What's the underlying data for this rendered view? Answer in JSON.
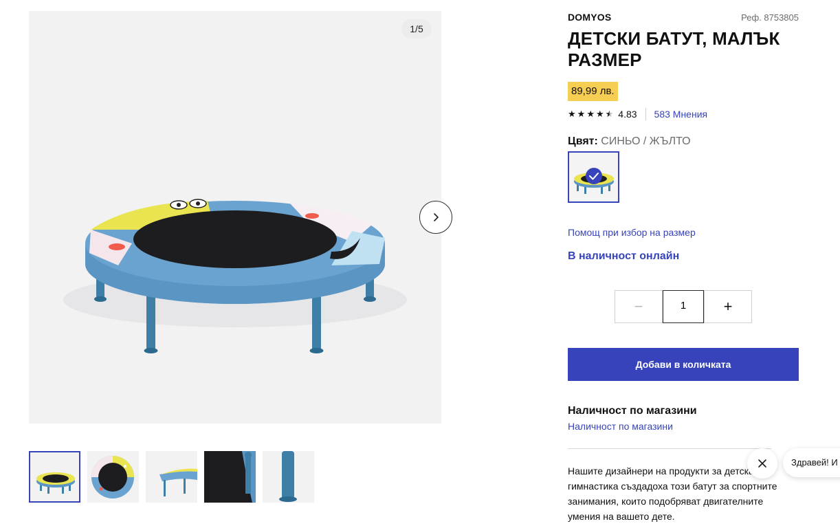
{
  "gallery": {
    "counter": "1/5",
    "next_icon": "chevron-right-icon",
    "thumbnails": [
      "trampoline-front",
      "trampoline-top",
      "trampoline-side",
      "trampoline-detail",
      "trampoline-leg"
    ]
  },
  "product": {
    "brand": "DOMYOS",
    "ref": "Реф. 8753805",
    "title": "ДЕТСКИ БАТУТ, МАЛЪК РАЗМЕР",
    "price": "89,99 лв.",
    "rating_value": "4.83",
    "rating_stars": 4.5,
    "reviews": "583 Мнения"
  },
  "color": {
    "label": "Цвят:",
    "value": "СИНЬО / ЖЪЛТО"
  },
  "links": {
    "size_help": "Помощ при избор на размер",
    "stock_online": "В наличност онлайн"
  },
  "quantity": {
    "minus": "−",
    "value": "1",
    "plus": "+"
  },
  "cart": {
    "add_label": "Добави в количката"
  },
  "stores": {
    "heading": "Наличност по магазини",
    "link": "Наличност по магазини"
  },
  "description": "Нашите дизайнери на продукти за детска гимнастика създадоха този батут за спортните занимания, които подобряват двигателните умения на вашето дете.",
  "chat": {
    "greeting": "Здравей! И",
    "close_icon": "close-icon"
  },
  "colors": {
    "accent": "#3643ba",
    "price_bg": "#f7ce54",
    "gallery_bg": "#f2f2f3"
  }
}
